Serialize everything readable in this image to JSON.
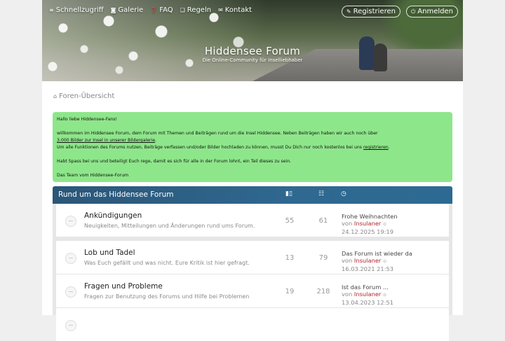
{
  "nav": {
    "items": [
      {
        "icon": "bars-icon",
        "glyph": "≡",
        "label": "Schnellzugriff"
      },
      {
        "icon": "camera-icon",
        "glyph": "◙",
        "label": "Galerie"
      },
      {
        "icon": "question-icon",
        "glyph": "❓",
        "label": "FAQ"
      },
      {
        "icon": "book-icon",
        "glyph": "❏",
        "label": "Regeln"
      },
      {
        "icon": "envelope-icon",
        "glyph": "✉",
        "label": "Kontakt"
      }
    ],
    "register_label": "Registrieren",
    "login_label": "Anmelden"
  },
  "site": {
    "title": "Hiddensee Forum",
    "subtitle": "Die Online-Community für Inselliebhaber"
  },
  "breadcrumb": {
    "icon": "home-icon",
    "label": "Foren-Übersicht"
  },
  "notice": {
    "greeting": "Hallo liebe Hiddensee-Fans!",
    "line1": "willkommen im Hiddensee Forum, dem Forum mit Themen und Beiträgen rund um die Insel Hiddensee. Neben Beiträgen haben wir auch noch über",
    "gallery_link": "3.000 Bilder zur Insel in unserer Bildergalerie",
    "line2_dot": ".",
    "line3": "Um alle Funktionen des Forums nutzen, Beiträge verfassen und/oder Bilder hochladen zu können, musst Du Dich nur noch kostenlos bei uns",
    "register_link": "registrieren",
    "line3_dot": ".",
    "line4": "Habt Spass bei uns und beteiligt Euch rege, damit es sich für alle in der Forum lohnt, ein Teil dieses zu sein.",
    "signoff": "Das Team vom Hiddensee-Forum",
    "background": "#8ee68a"
  },
  "forum_section": {
    "title": "Rund um das Hiddensee Forum",
    "topics_icon": "book-icon",
    "posts_icon": "comments-icon",
    "last_icon": "clock-icon",
    "header_color": "#2f6890"
  },
  "forums": [
    {
      "name": "Ankündigungen",
      "description": "Neuigkeiten, Mitteilungen und Änderungen rund ums Forum.",
      "topics": "55",
      "posts": "61",
      "last_title": "Frohe Weihnachten",
      "last_by": "von",
      "last_user": "Insulaner",
      "last_date": "24.12.2025 19:19"
    },
    {
      "name": "Lob und Tadel",
      "description": "Was Euch gefällt und was nicht. Eure Kritik ist hier gefragt.",
      "topics": "13",
      "posts": "79",
      "last_title": "Das Forum ist wieder da",
      "last_by": "von",
      "last_user": "Insulaner",
      "last_date": "16.03.2021 21:53"
    },
    {
      "name": "Fragen und Probleme",
      "description": "Fragen zur Benutzung des Forums und Hilfe bei Problemen",
      "topics": "19",
      "posts": "218",
      "last_title": "Ist das Forum ...",
      "last_by": "von",
      "last_user": "Insulaner",
      "last_date": "13.04.2023 12:51"
    }
  ]
}
